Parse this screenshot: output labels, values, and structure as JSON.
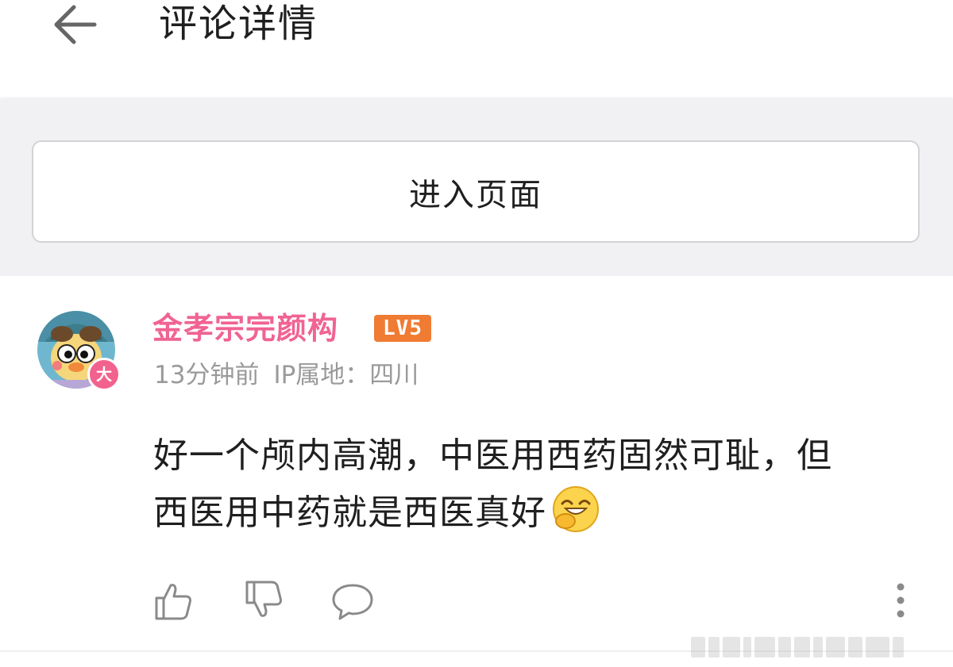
{
  "header": {
    "title": "评论详情",
    "back_icon": "arrow-left-icon"
  },
  "enter_page_button": {
    "label": "进入页面"
  },
  "comment": {
    "username": "金孝宗完颜构",
    "level": "LV5",
    "avatar_badge": "大",
    "time": "13分钟前",
    "ip_location": "IP属地：四川",
    "text_line1": "好一个颅内高潮，中医用西药固然可耻，但",
    "text_line2": "西医用中药就是西医真好",
    "emoji": "laugh-emoji-icon",
    "actions": [
      "thumbs-up-icon",
      "thumbs-down-icon",
      "comment-icon",
      "more-vertical-icon"
    ]
  },
  "colors": {
    "username": "#f06393",
    "level_badge": "#f07b33",
    "avatar_badge": "#f2628f",
    "meta_text": "#9a9a9a",
    "band": "#f1f1f3"
  }
}
